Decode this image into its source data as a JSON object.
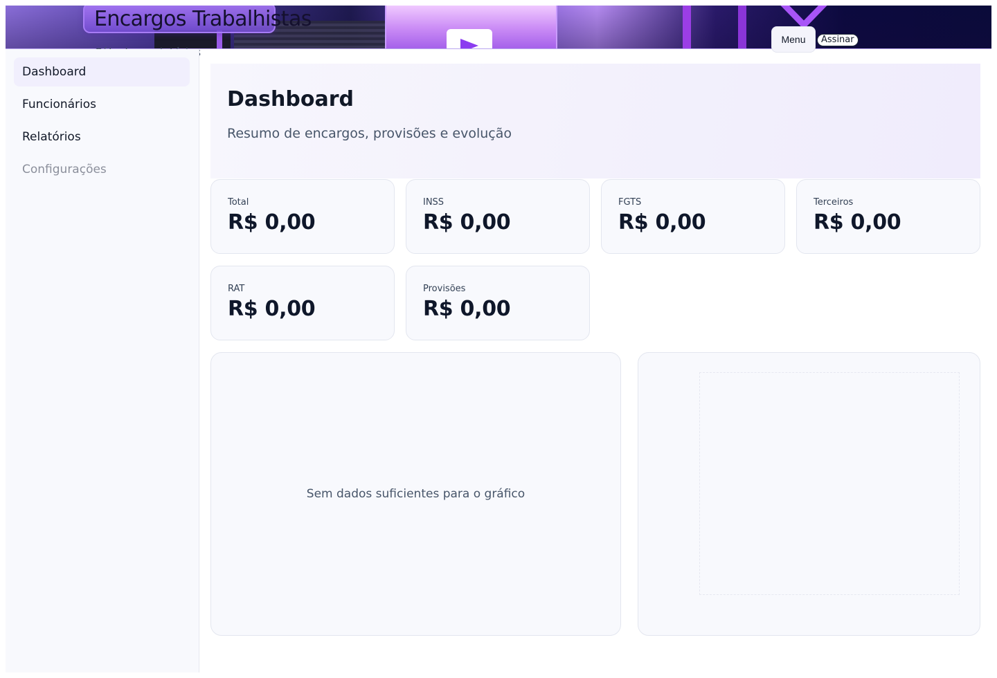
{
  "header": {
    "title": "Encargos Trabalhistas",
    "subtitle": "Cálculo e relatórios",
    "menu_label": "Menu",
    "sign_label": "Assinar"
  },
  "sidebar": {
    "items": [
      {
        "label": "Dashboard",
        "state": "active"
      },
      {
        "label": "Funcionários",
        "state": "normal"
      },
      {
        "label": "Relatórios",
        "state": "normal"
      },
      {
        "label": "Configurações",
        "state": "disabled"
      }
    ]
  },
  "main": {
    "title": "Dashboard",
    "subtitle": "Resumo de encargos, provisões e evolução",
    "stats": [
      {
        "label": "Total",
        "value": "R$ 0,00"
      },
      {
        "label": "INSS",
        "value": "R$ 0,00"
      },
      {
        "label": "FGTS",
        "value": "R$ 0,00"
      },
      {
        "label": "Terceiros",
        "value": "R$ 0,00"
      },
      {
        "label": "RAT",
        "value": "R$ 0,00"
      },
      {
        "label": "Provisões",
        "value": "R$ 0,00"
      }
    ],
    "chart_empty_message": "Sem dados suficientes para o gráfico"
  },
  "icons": {
    "banner_play": "play-icon"
  },
  "colors": {
    "accent": "#8b3cf0",
    "active_nav_bg": "#f1effd",
    "card_bg": "#f8f9fd"
  }
}
